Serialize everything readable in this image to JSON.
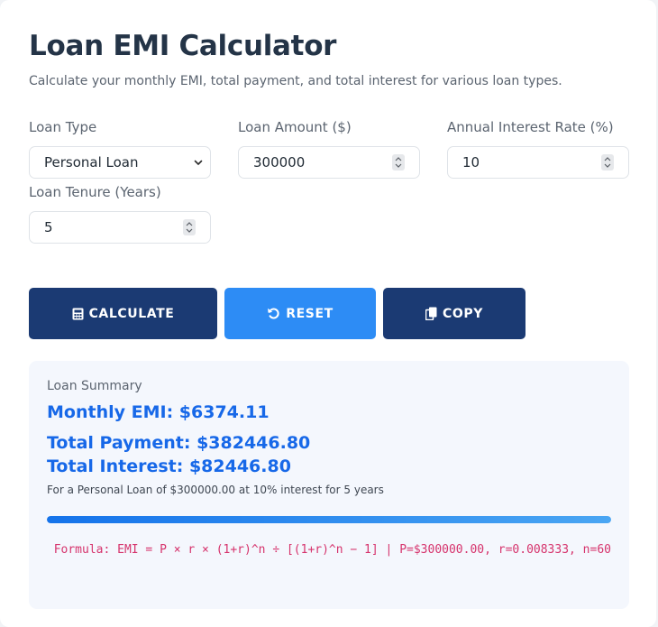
{
  "header": {
    "title": "Loan EMI Calculator",
    "subtitle": "Calculate your monthly EMI, total payment, and total interest for various loan types."
  },
  "form": {
    "loan_type": {
      "label": "Loan Type",
      "value": "Personal Loan"
    },
    "loan_amount": {
      "label": "Loan Amount ($)",
      "value": "300000"
    },
    "interest_rate": {
      "label": "Annual Interest Rate (%)",
      "value": "10"
    },
    "tenure": {
      "label": "Loan Tenure (Years)",
      "value": "5"
    }
  },
  "buttons": {
    "calculate": {
      "label": "CALCULATE",
      "icon": "calculator-icon"
    },
    "reset": {
      "label": "RESET",
      "icon": "reset-icon"
    },
    "copy": {
      "label": "COPY",
      "icon": "copy-icon"
    }
  },
  "summary": {
    "label": "Loan Summary",
    "monthly_emi": "Monthly EMI: $6374.11",
    "total_payment": "Total Payment: $382446.80",
    "total_interest": "Total Interest: $82446.80",
    "detail": "For a Personal Loan of $300000.00 at 10% interest for 5 years",
    "progress_fraction": 1.0,
    "formula": "Formula: EMI = P × r × (1+r)^n ÷ [(1+r)^n − 1] | P=$300000.00, r=0.008333, n=60"
  },
  "colors": {
    "title": "#243447",
    "dark_button": "#1b3a73",
    "blue_button": "#2d8cf5",
    "accent_text": "#1768e8",
    "formula_text": "#d6336c",
    "summary_bg": "#f4f7fd"
  }
}
